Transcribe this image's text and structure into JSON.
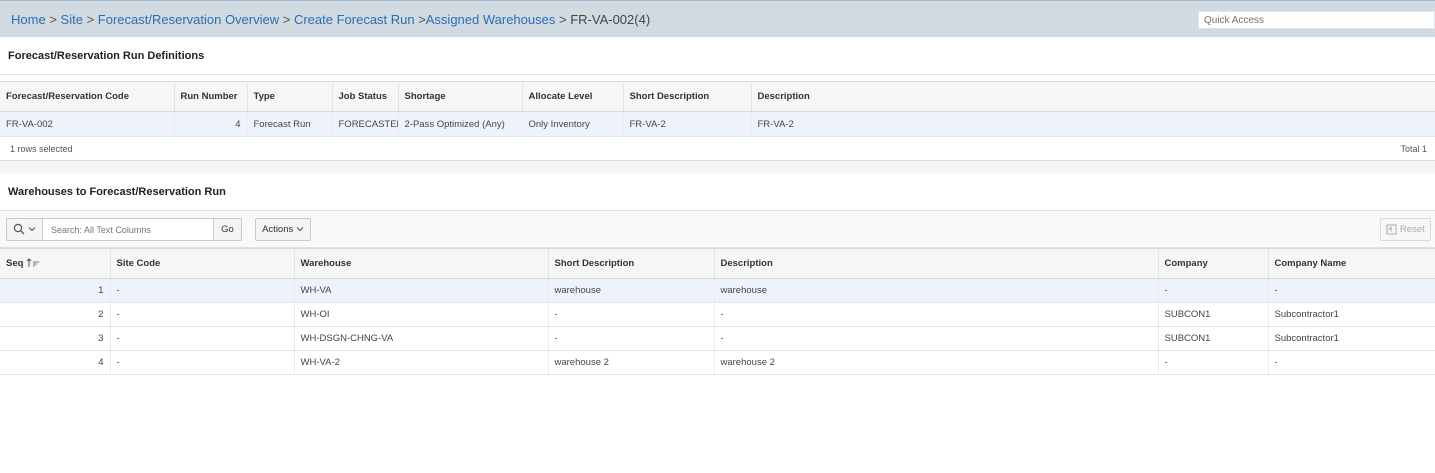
{
  "breadcrumb": {
    "home": "Home",
    "site": "Site",
    "overview": "Forecast/Reservation Overview",
    "create": "Create Forecast Run",
    "assigned": "Assigned Warehouses",
    "current": "FR-VA-002(4)",
    "separator": ">"
  },
  "quick_access": {
    "placeholder": "Quick Access"
  },
  "definitions": {
    "title": "Forecast/Reservation Run Definitions",
    "columns": [
      "Forecast/Reservation Code",
      "Run Number",
      "Type",
      "Job Status",
      "Shortage",
      "Allocate Level",
      "Short Description",
      "Description"
    ],
    "rows": [
      [
        "FR-VA-002",
        "4",
        "Forecast Run",
        "FORECASTED",
        "2-Pass Optimized (Any)",
        "Only Inventory",
        "FR-VA-2",
        "FR-VA-2"
      ]
    ],
    "rows_selected": "1 rows selected",
    "total": "Total 1"
  },
  "warehouses": {
    "title": "Warehouses to Forecast/Reservation Run",
    "search_placeholder": "Search: All Text Columns",
    "go_label": "Go",
    "actions_label": "Actions",
    "reset_label": "Reset",
    "columns": [
      "Seq",
      "Site Code",
      "Warehouse",
      "Short Description",
      "Description",
      "Company",
      "Company Name"
    ],
    "rows": [
      [
        "1",
        "-",
        "WH-VA",
        "warehouse",
        "warehouse",
        "-",
        "-"
      ],
      [
        "2",
        "-",
        "WH-OI",
        "-",
        "-",
        "SUBCON1",
        "Subcontractor1"
      ],
      [
        "3",
        "-",
        "WH-DSGN-CHNG-VA",
        "-",
        "-",
        "SUBCON1",
        "Subcontractor1"
      ],
      [
        "4",
        "-",
        "WH-VA-2",
        "warehouse 2",
        "warehouse 2",
        "-",
        "-"
      ]
    ]
  },
  "icons": {
    "search": "magnifier-icon",
    "dropdown": "chevron-down-icon",
    "sort": "sort-ascending-icon",
    "reset": "reset-icon"
  }
}
